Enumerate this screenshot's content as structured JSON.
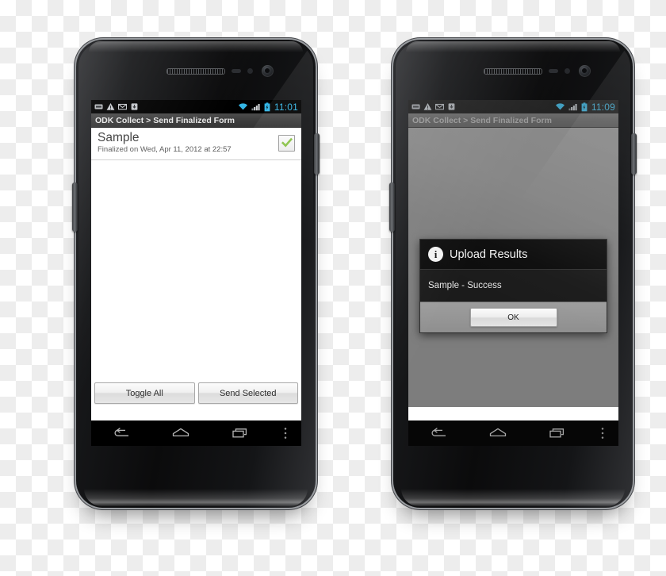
{
  "scene": {
    "description": "Two Android phones side by side showing ODK Collect Send Finalized Form screen"
  },
  "phone_left": {
    "status_bar": {
      "time": "11:01",
      "notification_icons": [
        "usb-icon",
        "warning-icon",
        "mail-icon",
        "download-icon"
      ],
      "system_icons": [
        "wifi-icon",
        "signal-icon",
        "battery-icon"
      ],
      "accent_color": "#33b5e5"
    },
    "title_bar": {
      "text": "ODK Collect > Send Finalized Form"
    },
    "list": {
      "items": [
        {
          "title": "Sample",
          "subtitle": "Finalized on Wed, Apr 11, 2012 at 22:57",
          "checked": true,
          "check_color": "#8bc34a"
        }
      ]
    },
    "buttons": {
      "toggle_all": "Toggle All",
      "send_selected": "Send Selected"
    },
    "nav_bar": {
      "back": "back-icon",
      "home": "home-icon",
      "recents": "recents-icon",
      "menu": "menu-icon"
    }
  },
  "phone_right": {
    "status_bar": {
      "time": "11:09",
      "notification_icons": [
        "usb-icon",
        "warning-icon",
        "mail-icon",
        "download-icon"
      ],
      "system_icons": [
        "wifi-icon",
        "signal-icon",
        "battery-icon"
      ],
      "accent_color": "#33b5e5"
    },
    "title_bar": {
      "text": "ODK Collect > Send Finalized Form"
    },
    "dialog": {
      "icon": "info-icon",
      "icon_glyph": "i",
      "title": "Upload Results",
      "message": "Sample - Success",
      "ok_label": "OK"
    },
    "nav_bar": {
      "back": "back-icon",
      "home": "home-icon",
      "recents": "recents-icon",
      "menu": "menu-icon"
    }
  }
}
